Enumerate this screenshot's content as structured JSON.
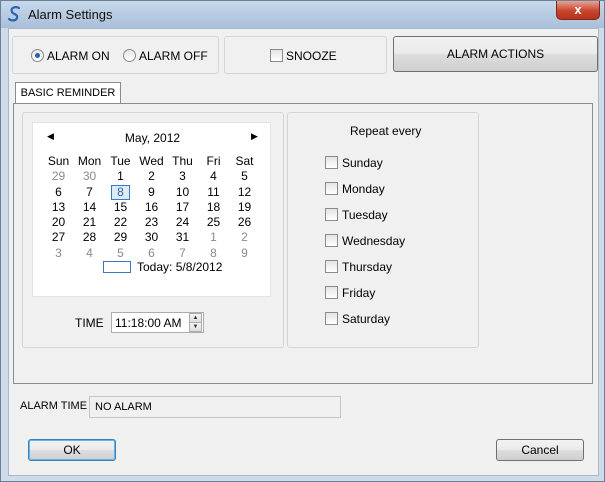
{
  "window": {
    "title": "Alarm Settings",
    "close_label": "x"
  },
  "top": {
    "alarm_on_label": "ALARM ON",
    "alarm_off_label": "ALARM OFF",
    "alarm_on_selected": true,
    "snooze_label": "SNOOZE",
    "snooze_checked": false,
    "alarm_actions_label": "ALARM ACTIONS"
  },
  "tabs": [
    {
      "label": "BASIC REMINDER",
      "active": true
    }
  ],
  "calendar": {
    "month_label": "May, 2012",
    "prev_arrow": "◀",
    "next_arrow": "▶",
    "weekdays": [
      "Sun",
      "Mon",
      "Tue",
      "Wed",
      "Thu",
      "Fri",
      "Sat"
    ],
    "weeks": [
      [
        "29",
        "30",
        "1",
        "2",
        "3",
        "4",
        "5"
      ],
      [
        "6",
        "7",
        "8",
        "9",
        "10",
        "11",
        "12"
      ],
      [
        "13",
        "14",
        "15",
        "16",
        "17",
        "18",
        "19"
      ],
      [
        "20",
        "21",
        "22",
        "23",
        "24",
        "25",
        "26"
      ],
      [
        "27",
        "28",
        "29",
        "30",
        "31",
        "1",
        "2"
      ],
      [
        "3",
        "4",
        "5",
        "6",
        "7",
        "8",
        "9"
      ]
    ],
    "selected_day": "8",
    "today_label": "Today: 5/8/2012"
  },
  "time": {
    "label": "TIME",
    "value": "11:18:00 AM"
  },
  "repeat": {
    "title": "Repeat every",
    "days": [
      {
        "label": "Sunday",
        "checked": false
      },
      {
        "label": "Monday",
        "checked": false
      },
      {
        "label": "Tuesday",
        "checked": false
      },
      {
        "label": "Wednesday",
        "checked": false
      },
      {
        "label": "Thursday",
        "checked": false
      },
      {
        "label": "Friday",
        "checked": false
      },
      {
        "label": "Saturday",
        "checked": false
      }
    ]
  },
  "alarm_time": {
    "label": "ALARM TIME",
    "value": "NO ALARM"
  },
  "footer": {
    "ok_label": "OK",
    "cancel_label": "Cancel"
  },
  "colors": {
    "title_bar": "#a9bfd8",
    "close_button": "#c7442e",
    "focus_border": "#3a7bbf"
  }
}
